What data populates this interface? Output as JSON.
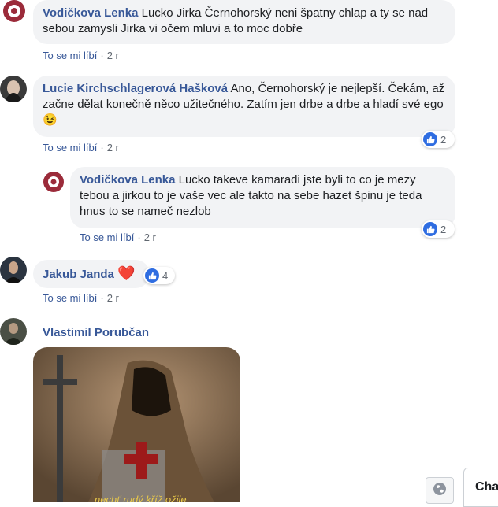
{
  "comments": [
    {
      "author": "Vodičkova Lenka",
      "text": "Lucko Jirka Černohorský neni špatny chlap a ty se nad sebou zamysli Jirka vi očem mluvi a to moc dobře",
      "like_label": "To se mi líbí",
      "time": "2 r"
    },
    {
      "author": "Lucie Kirchschlagerová Hašková",
      "text": "Ano, Černohorský je nejlepší. Čekám, až začne dělat konečně něco užitečného. Zatím jen drbe a drbe a hladí své ego 😉",
      "like_label": "To se mi líbí",
      "time": "2 r",
      "reaction_count": "2"
    },
    {
      "author": "Vodičkova Lenka",
      "text": "Lucko takeve kamaradi jste byli to co je mezy tebou a jirkou to je vaše vec ale takto na sebe hazet špinu je teda hnus to se nameč nezlob",
      "like_label": "To se mi líbí",
      "time": "2 r",
      "reaction_count": "2"
    },
    {
      "author": "Jakub Janda",
      "text": "❤️",
      "like_label": "To se mi líbí",
      "time": "2 r",
      "reaction_count": "4"
    },
    {
      "author": "Vlastimil Porubčan",
      "image_caption": "nechť rudý kříž ožije"
    }
  ],
  "chat": {
    "label": "Cha"
  },
  "icons": {
    "like": "thumbs-up-icon",
    "globe": "globe-icon"
  },
  "colors": {
    "name": "#385898",
    "bubble": "#f2f3f5",
    "meta": "#606770",
    "like": "#2f6de1"
  }
}
